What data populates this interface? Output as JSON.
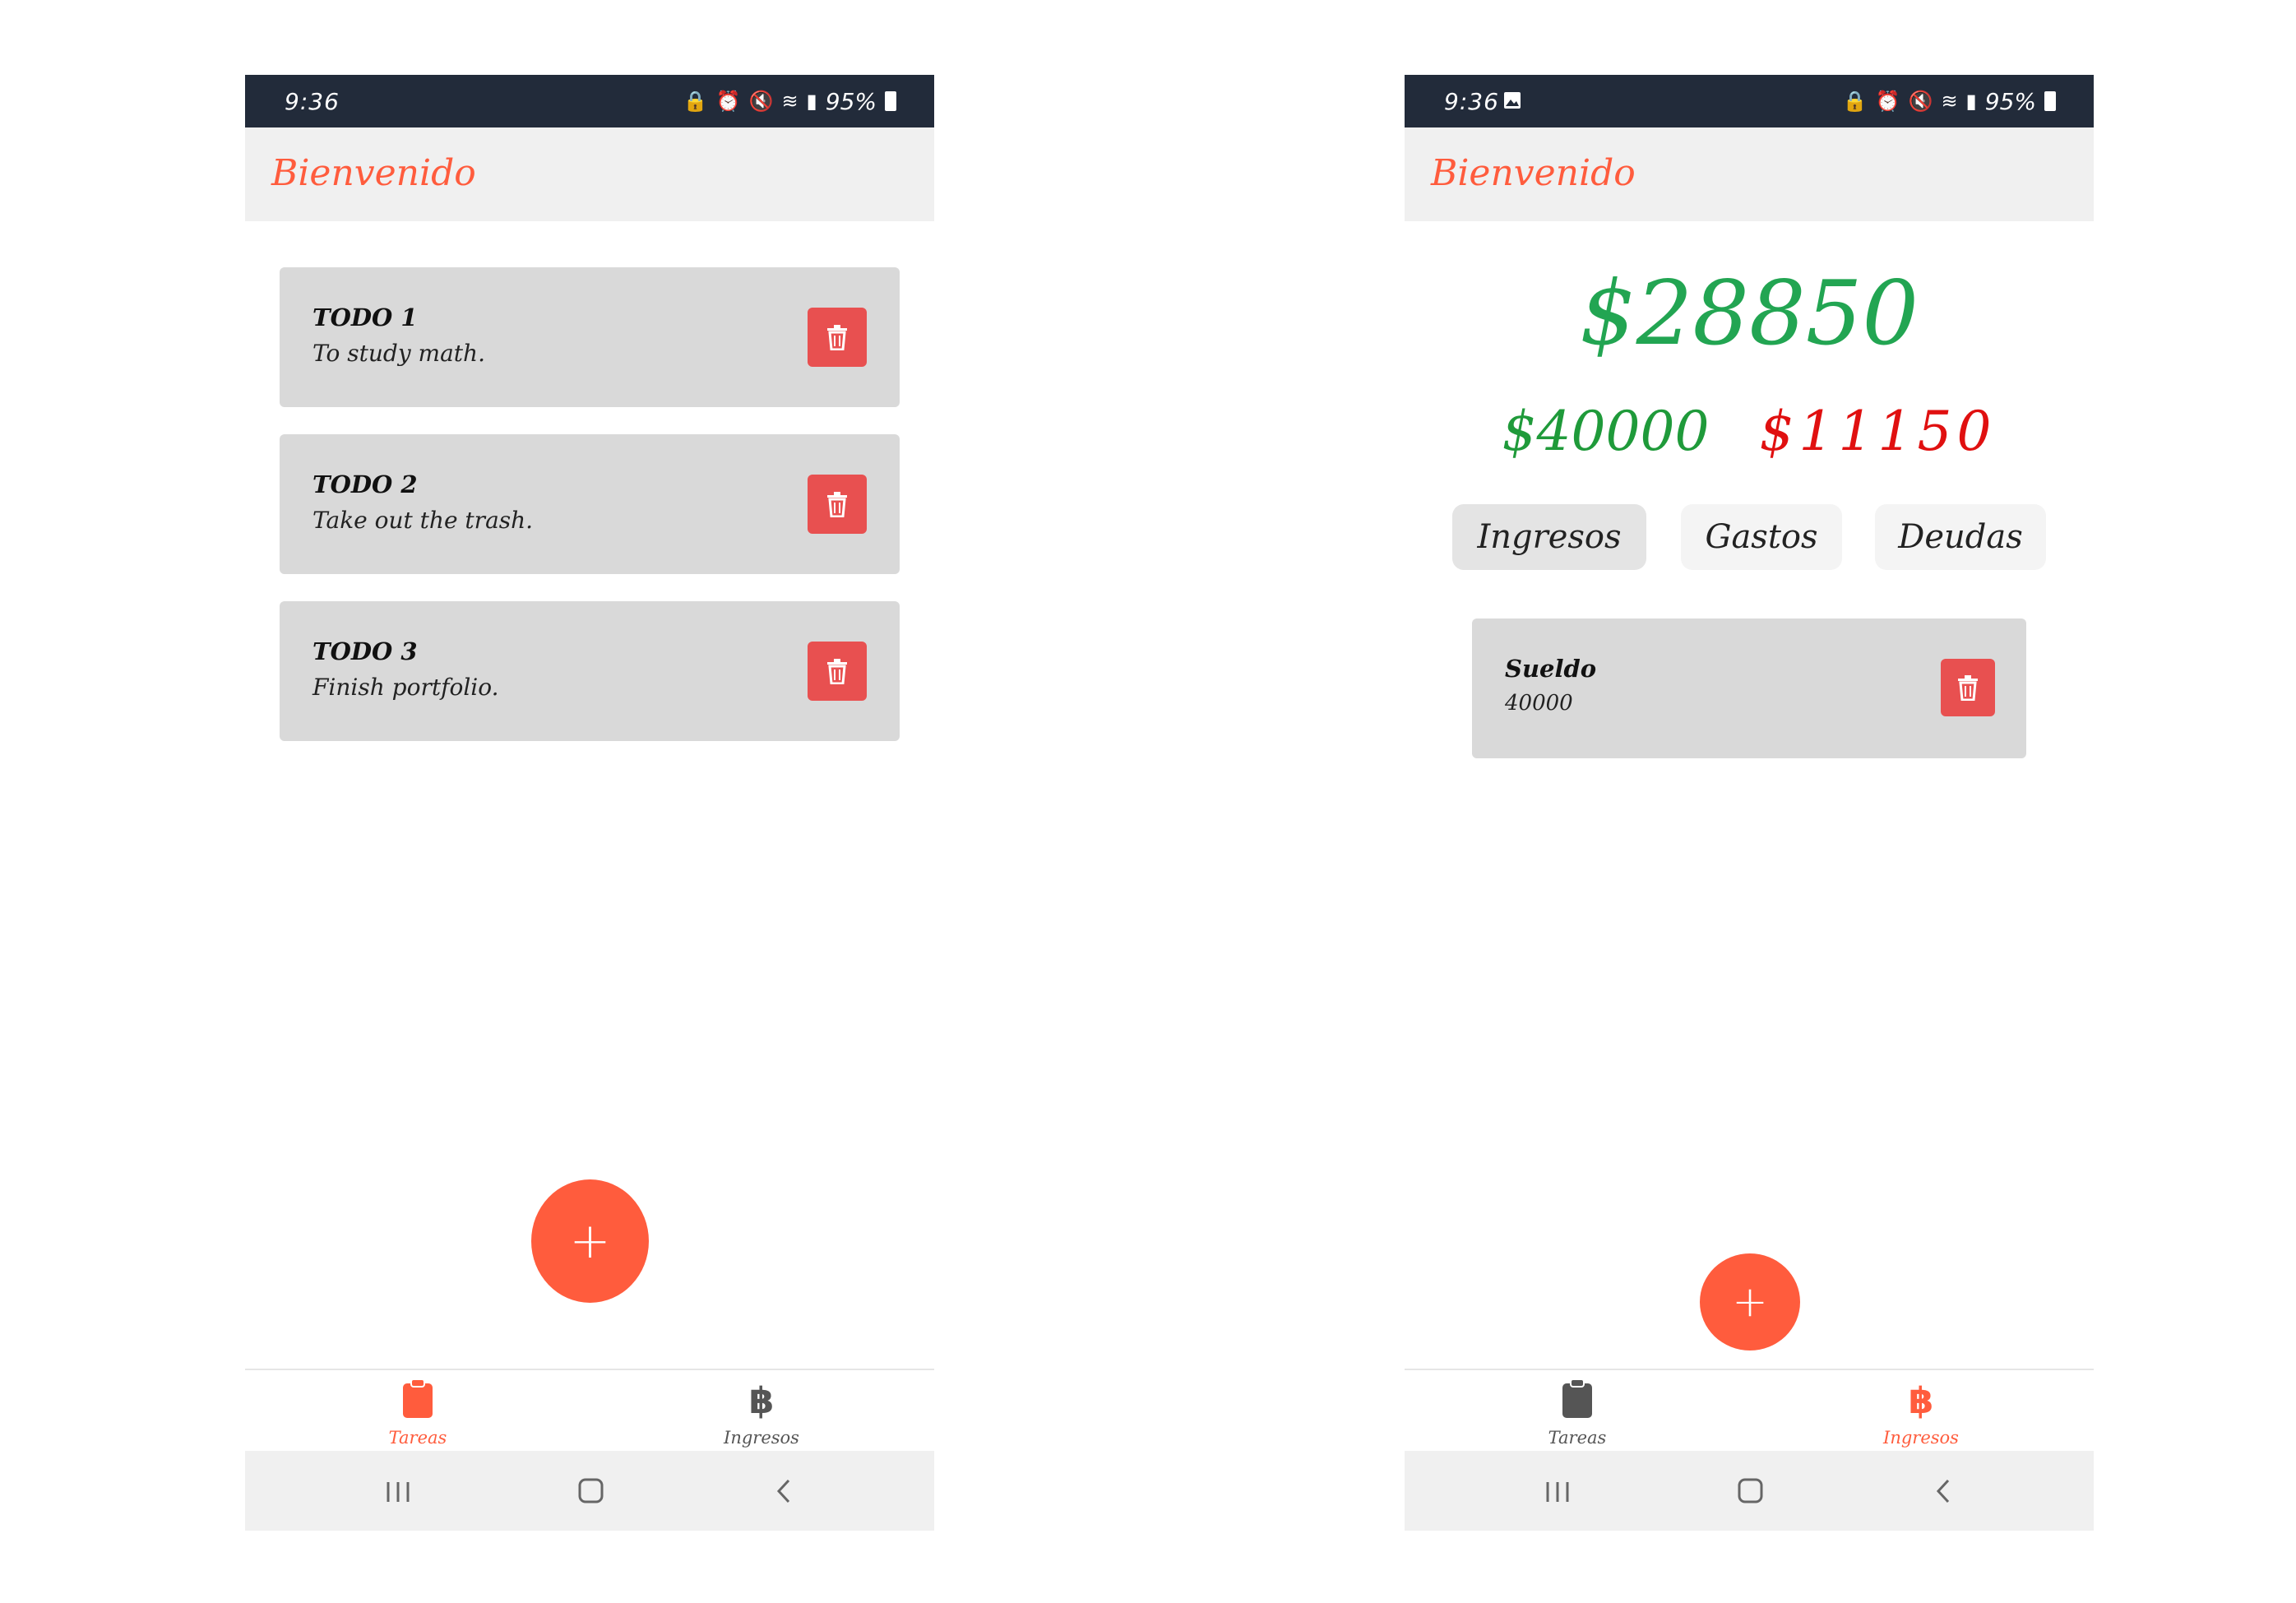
{
  "screens": {
    "left": {
      "status_bar": {
        "time": "9:36",
        "battery": "95%"
      },
      "header": {
        "title": "Bienvenido"
      },
      "todos": [
        {
          "title": "TODO 1",
          "description": "To study math."
        },
        {
          "title": "TODO 2",
          "description": "Take out the trash."
        },
        {
          "title": "TODO 3",
          "description": "Finish portfolio."
        }
      ],
      "fab": {
        "label": "+"
      },
      "bottom_nav": {
        "items": [
          {
            "label": "Tareas",
            "icon": "clipboard-icon",
            "active": true
          },
          {
            "label": "Ingresos",
            "icon": "bitcoin-icon",
            "active": false
          }
        ]
      }
    },
    "right": {
      "status_bar": {
        "time": "9:36",
        "battery": "95%"
      },
      "header": {
        "title": "Bienvenido"
      },
      "balance": {
        "total": "$28850",
        "income": "$40000",
        "expenses": "$11150"
      },
      "tabs": [
        {
          "label": "Ingresos",
          "active": true
        },
        {
          "label": "Gastos",
          "active": false
        },
        {
          "label": "Deudas",
          "active": false
        }
      ],
      "entries": [
        {
          "title": "Sueldo",
          "amount": "40000"
        }
      ],
      "fab": {
        "label": "+"
      },
      "bottom_nav": {
        "items": [
          {
            "label": "Tareas",
            "icon": "clipboard-icon",
            "active": false
          },
          {
            "label": "Ingresos",
            "icon": "bitcoin-icon",
            "active": true
          }
        ]
      }
    }
  },
  "colors": {
    "accent": "#ff5c3d",
    "delete": "#e85050",
    "status_bar": "#222b3a",
    "balance_total": "#22a552",
    "income": "#1f9a3a",
    "expense": "#e01010",
    "inactive_nav": "#555555"
  }
}
